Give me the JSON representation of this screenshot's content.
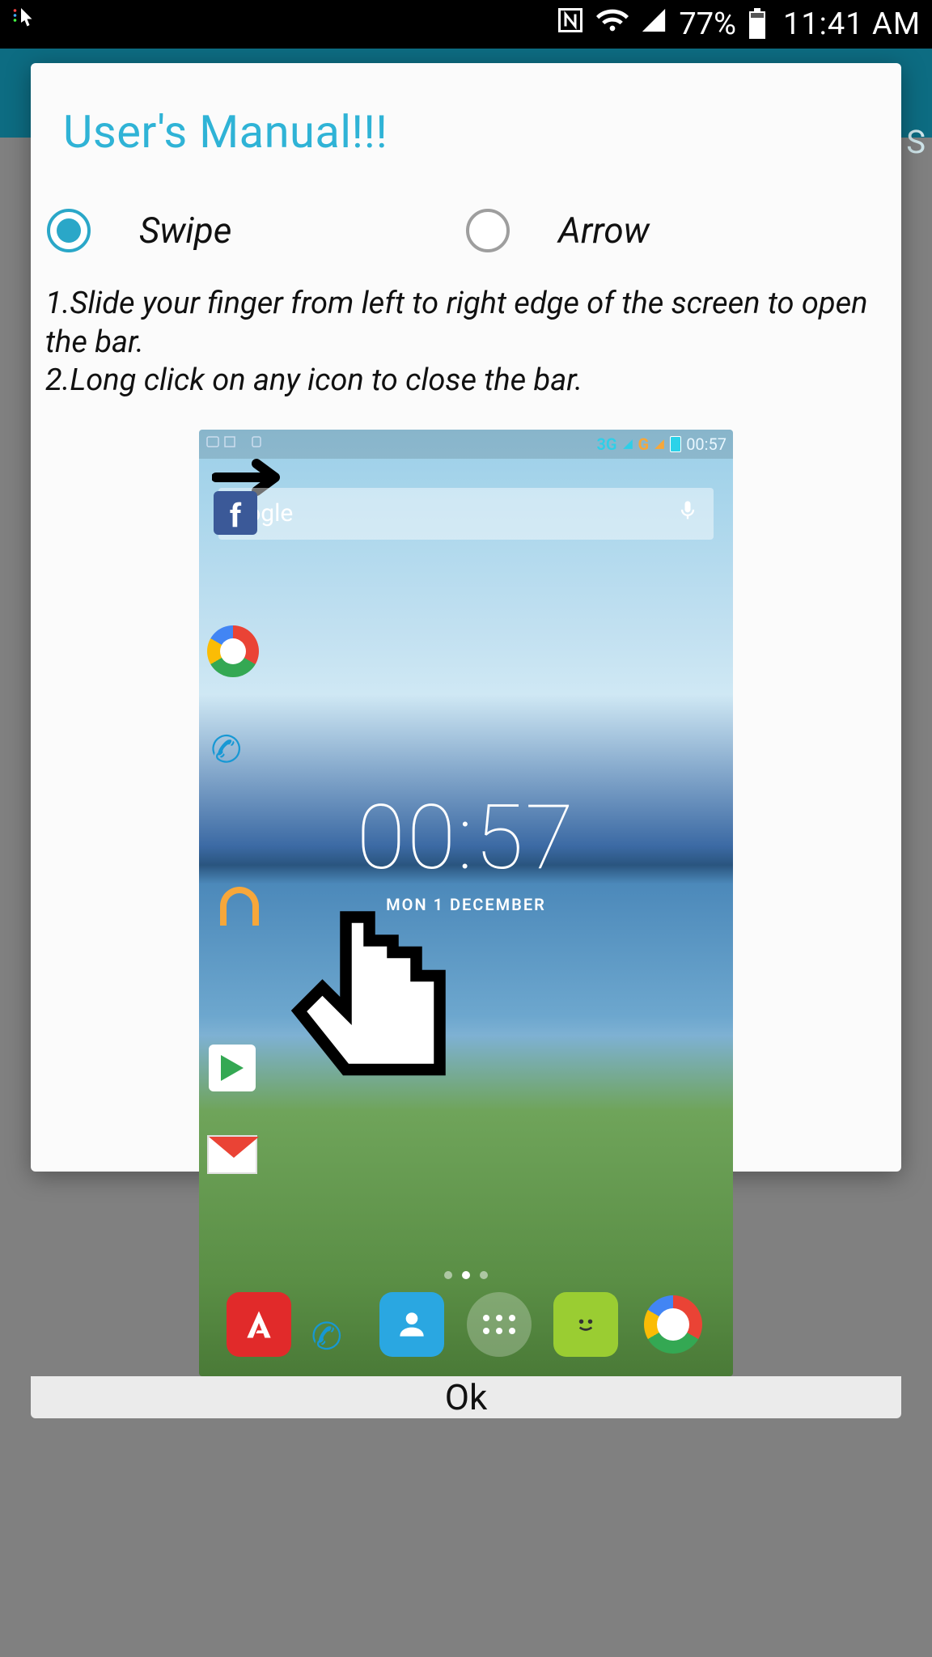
{
  "status_bar": {
    "battery_percent": "77%",
    "time": "11:41 AM"
  },
  "dialog": {
    "title": "User's Manual!!!",
    "radios": {
      "swipe_label": "Swipe",
      "arrow_label": "Arrow"
    },
    "instructions": "1.Slide your finger from left to right edge of the screen to open the bar.\n2.Long click on any icon to close the bar.",
    "ok_label": "Ok"
  },
  "illustration": {
    "status": {
      "net_3g": "3G",
      "g": "G",
      "time": "00:57"
    },
    "search_placeholder": "oogle",
    "clock_time": "00:57",
    "clock_date": "MON 1 DECEMBER"
  }
}
